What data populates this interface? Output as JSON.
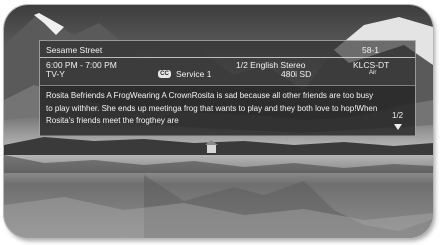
{
  "program": {
    "title": "Sesame Street",
    "channel_number": "58-1",
    "time": "6:00 PM - 7:00 PM",
    "rating": "TV-Y",
    "cc_icon": "closed-captions-icon",
    "cc_label": "CC",
    "service": "Service 1",
    "audio": "1/2 English Stereo",
    "resolution": "480i SD",
    "station": "KLCS-DT",
    "broadcast_type": "Air"
  },
  "description": {
    "text": "Rosita Befriends A FrogWearing A CrownRosita is sad because all other friends are too busy to play withher. She ends up meetinga frog that wants to play and they both love to hop!When Rosita's friends meet the frogthey are",
    "page": "1/2",
    "scroll_icon": "triangle-down-icon"
  }
}
